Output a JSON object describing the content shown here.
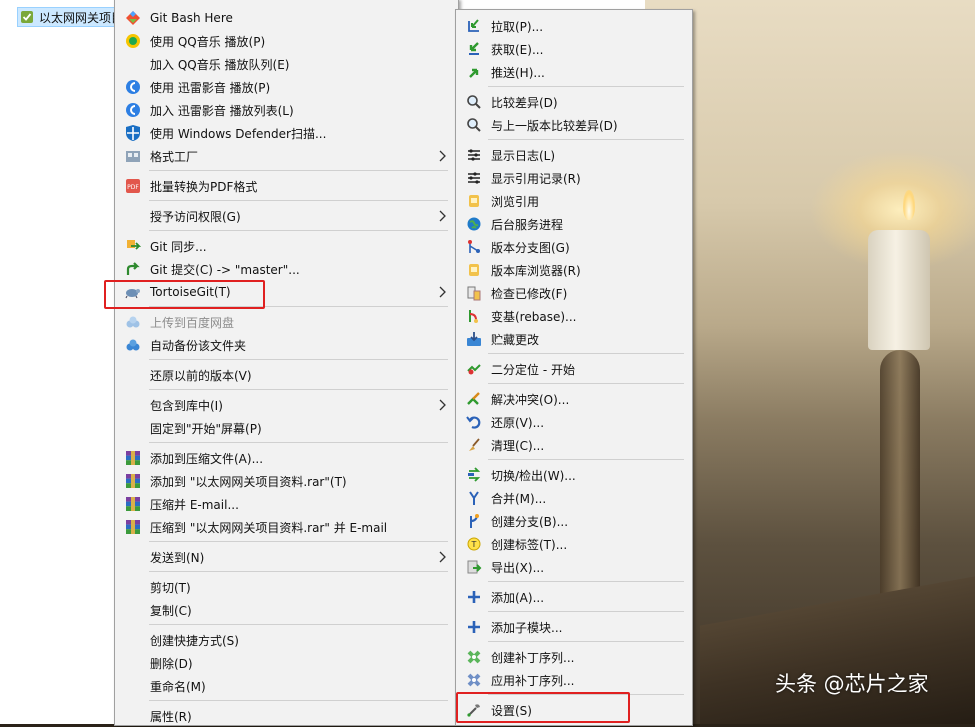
{
  "explorer": {
    "selected_file": "以太网网关项目资料.rar"
  },
  "context_menu": {
    "items": [
      {
        "label": "Git Bash Here",
        "icon": "git-bash-icon"
      },
      {
        "label": "使用 QQ音乐 播放(P)",
        "icon": "qq-music-icon"
      },
      {
        "label": "加入 QQ音乐 播放队列(E)",
        "icon": "none"
      },
      {
        "label": "使用 迅雷影音 播放(P)",
        "icon": "xunlei-player-icon"
      },
      {
        "label": "加入 迅雷影音 播放列表(L)",
        "icon": "xunlei-player-icon"
      },
      {
        "label": "使用 Windows Defender扫描...",
        "icon": "windows-defender-icon"
      },
      {
        "label": "格式工厂",
        "icon": "format-factory-icon"
      },
      {
        "label": "批量转换为PDF格式",
        "icon": "pdf-icon"
      },
      {
        "label": "授予访问权限(G)",
        "icon": "none"
      },
      {
        "label": "Git 同步...",
        "icon": "git-sync-icon"
      },
      {
        "label": "Git 提交(C) -> \"master\"...",
        "icon": "git-commit-icon"
      },
      {
        "label": "TortoiseGit(T)",
        "icon": "tortoisegit-icon"
      },
      {
        "label": "上传到百度网盘",
        "icon": "baidu-netdisk-icon"
      },
      {
        "label": "自动备份该文件夹",
        "icon": "baidu-netdisk-icon"
      },
      {
        "label": "还原以前的版本(V)",
        "icon": "none"
      },
      {
        "label": "包含到库中(I)",
        "icon": "none"
      },
      {
        "label": "固定到\"开始\"屏幕(P)",
        "icon": "none"
      },
      {
        "label": "添加到压缩文件(A)...",
        "icon": "winrar-icon"
      },
      {
        "label": "添加到 \"以太网网关项目资料.rar\"(T)",
        "icon": "winrar-icon"
      },
      {
        "label": "压缩并 E-mail...",
        "icon": "winrar-icon"
      },
      {
        "label": "压缩到 \"以太网网关项目资料.rar\" 并 E-mail",
        "icon": "winrar-icon"
      },
      {
        "label": "发送到(N)",
        "icon": "none"
      },
      {
        "label": "剪切(T)",
        "icon": "none"
      },
      {
        "label": "复制(C)",
        "icon": "none"
      },
      {
        "label": "创建快捷方式(S)",
        "icon": "none"
      },
      {
        "label": "删除(D)",
        "icon": "none"
      },
      {
        "label": "重命名(M)",
        "icon": "none"
      },
      {
        "label": "属性(R)",
        "icon": "none"
      }
    ]
  },
  "tortoisegit_submenu": {
    "items": [
      {
        "label": "拉取(P)...",
        "icon": "pull-icon"
      },
      {
        "label": "获取(E)...",
        "icon": "fetch-icon"
      },
      {
        "label": "推送(H)...",
        "icon": "push-icon"
      },
      {
        "label": "比较差异(D)",
        "icon": "diff-icon"
      },
      {
        "label": "与上一版本比较差异(D)",
        "icon": "diff-icon"
      },
      {
        "label": "显示日志(L)",
        "icon": "log-icon"
      },
      {
        "label": "显示引用记录(R)",
        "icon": "reflog-icon"
      },
      {
        "label": "浏览引用",
        "icon": "browse-refs-icon"
      },
      {
        "label": "后台服务进程",
        "icon": "daemon-icon"
      },
      {
        "label": "版本分支图(G)",
        "icon": "revision-graph-icon"
      },
      {
        "label": "版本库浏览器(R)",
        "icon": "repo-browser-icon"
      },
      {
        "label": "检查已修改(F)",
        "icon": "check-modifications-icon"
      },
      {
        "label": "变基(rebase)...",
        "icon": "rebase-icon"
      },
      {
        "label": "贮藏更改",
        "icon": "stash-icon"
      },
      {
        "label": "二分定位 - 开始",
        "icon": "bisect-icon"
      },
      {
        "label": "解决冲突(O)...",
        "icon": "resolve-icon"
      },
      {
        "label": "还原(V)...",
        "icon": "revert-icon"
      },
      {
        "label": "清理(C)...",
        "icon": "cleanup-icon"
      },
      {
        "label": "切换/检出(W)...",
        "icon": "switch-icon"
      },
      {
        "label": "合并(M)...",
        "icon": "merge-icon"
      },
      {
        "label": "创建分支(B)...",
        "icon": "branch-icon"
      },
      {
        "label": "创建标签(T)...",
        "icon": "tag-icon"
      },
      {
        "label": "导出(X)...",
        "icon": "export-icon"
      },
      {
        "label": "添加(A)...",
        "icon": "add-icon"
      },
      {
        "label": "添加子模块...",
        "icon": "add-submodule-icon"
      },
      {
        "label": "创建补丁序列...",
        "icon": "create-patch-icon"
      },
      {
        "label": "应用补丁序列...",
        "icon": "apply-patch-icon"
      },
      {
        "label": "设置(S)",
        "icon": "settings-icon"
      }
    ]
  },
  "watermark": "头条 @芯片之家",
  "colors": {
    "highlight_box": "#e02020",
    "menu_bg": "#f2f2f2",
    "selected_file_bg": "#cce8ff"
  }
}
